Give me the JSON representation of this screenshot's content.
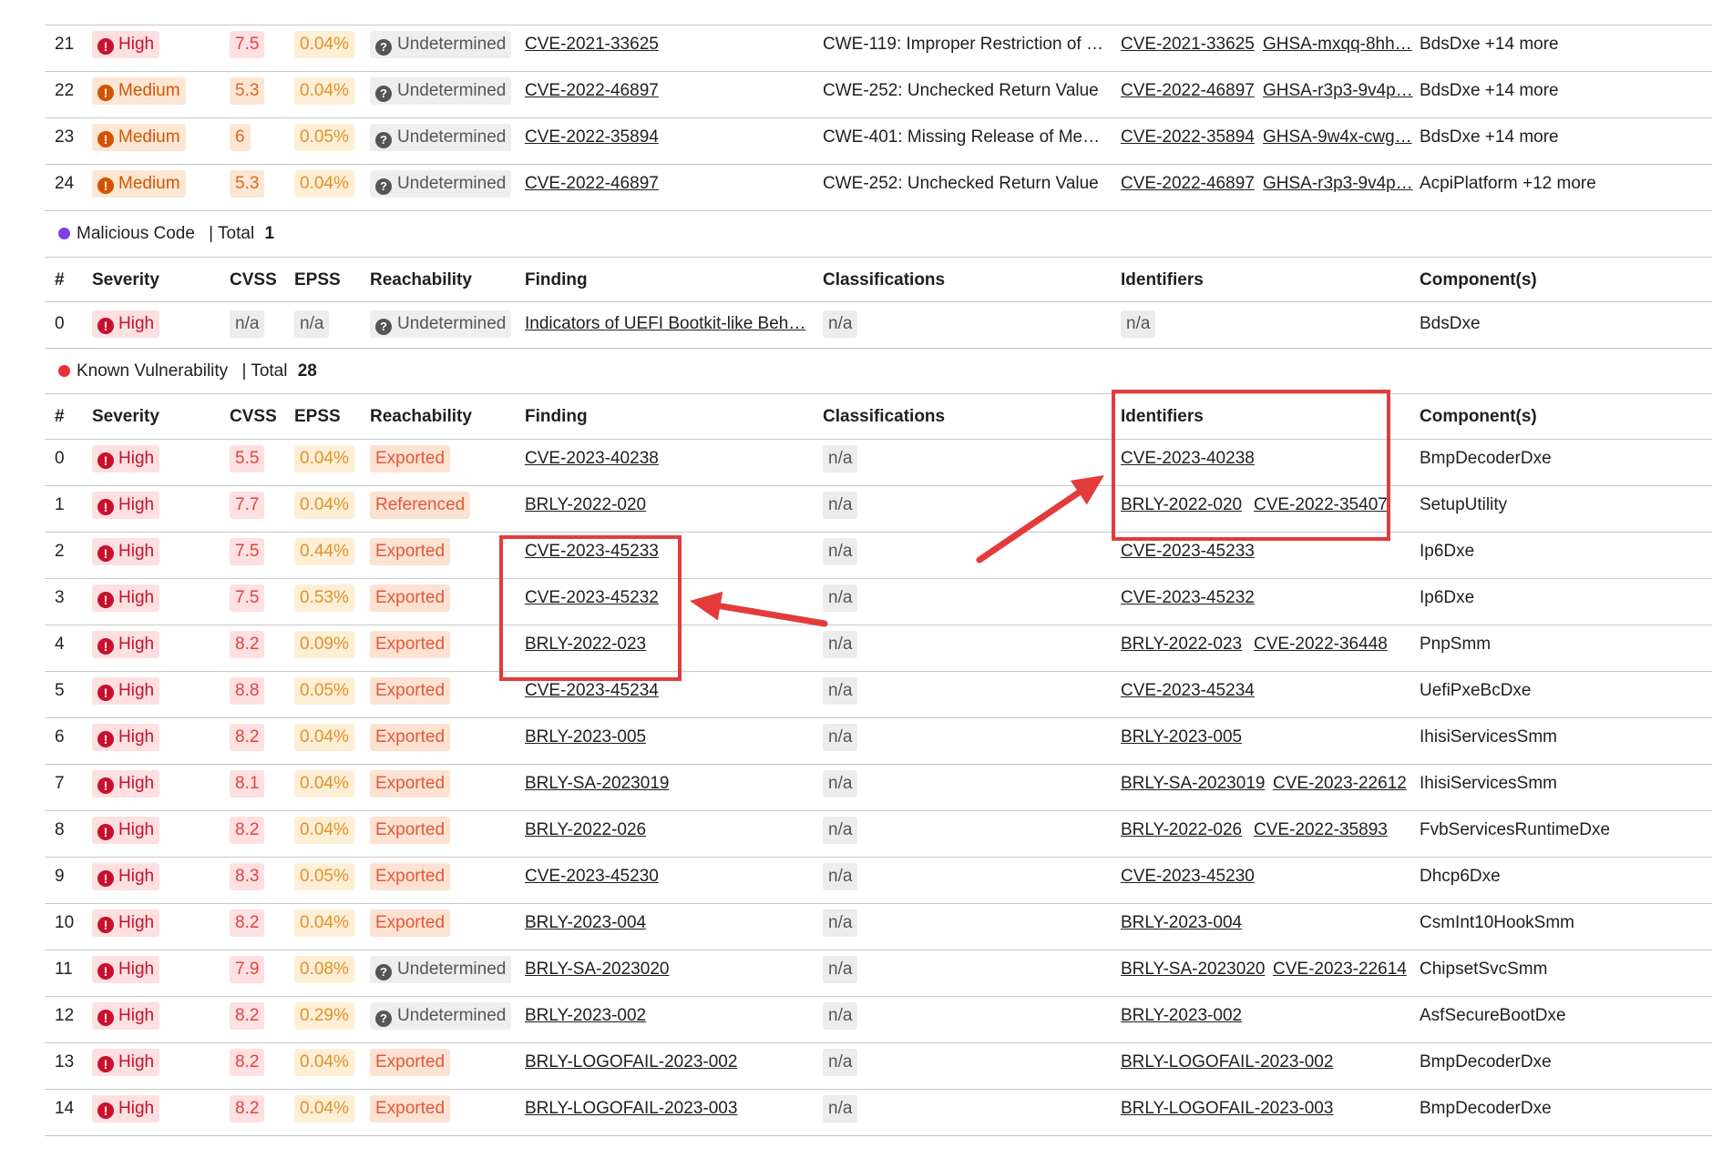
{
  "top_rows": [
    {
      "num": "21",
      "severity": "High",
      "sev_level": "high",
      "cvss": "7.5",
      "cvss_level": "high",
      "epss": "0.04%",
      "reach": "Undetermined",
      "finding": "CVE-2021-33625",
      "classification": "CWE-119: Improper Restriction of …",
      "identifiers": [
        "CVE-2021-33625",
        "GHSA-mxqq-8hh…"
      ],
      "component": "BdsDxe +14 more"
    },
    {
      "num": "22",
      "severity": "Medium",
      "sev_level": "med",
      "cvss": "5.3",
      "cvss_level": "med",
      "epss": "0.04%",
      "reach": "Undetermined",
      "finding": "CVE-2022-46897",
      "classification": "CWE-252: Unchecked Return Value",
      "identifiers": [
        "CVE-2022-46897",
        "GHSA-r3p3-9v4p…"
      ],
      "component": "BdsDxe +14 more"
    },
    {
      "num": "23",
      "severity": "Medium",
      "sev_level": "med",
      "cvss": "6",
      "cvss_level": "med",
      "epss": "0.05%",
      "reach": "Undetermined",
      "finding": "CVE-2022-35894",
      "classification": "CWE-401: Missing Release of Me…",
      "identifiers": [
        "CVE-2022-35894",
        "GHSA-9w4x-cwg…"
      ],
      "component": "BdsDxe +14 more"
    },
    {
      "num": "24",
      "severity": "Medium",
      "sev_level": "med",
      "cvss": "5.3",
      "cvss_level": "med",
      "epss": "0.04%",
      "reach": "Undetermined",
      "finding": "CVE-2022-46897",
      "classification": "CWE-252: Unchecked Return Value",
      "identifiers": [
        "CVE-2022-46897",
        "GHSA-r3p3-9v4p…"
      ],
      "component": "AcpiPlatform +12 more"
    }
  ],
  "malicious": {
    "label": "Malicious Code",
    "total_label": "| Total",
    "total": "1",
    "dot_color": "#7b3fe4",
    "headers": {
      "num": "#",
      "severity": "Severity",
      "cvss": "CVSS",
      "epss": "EPSS",
      "reachability": "Reachability",
      "finding": "Finding",
      "classifications": "Classifications",
      "identifiers": "Identifiers",
      "components": "Component(s)"
    },
    "row": {
      "num": "0",
      "severity": "High",
      "cvss": "n/a",
      "epss": "n/a",
      "reach": "Undetermined",
      "finding": "Indicators of UEFI Bootkit-like Beh…",
      "classification": "n/a",
      "identifiers": "n/a",
      "component": "BdsDxe"
    }
  },
  "known": {
    "label": "Known Vulnerability",
    "total_label": "| Total",
    "total": "28",
    "dot_color": "#e8303a",
    "headers": {
      "num": "#",
      "severity": "Severity",
      "cvss": "CVSS",
      "epss": "EPSS",
      "reachability": "Reachability",
      "finding": "Finding",
      "classifications": "Classifications",
      "identifiers": "Identifiers",
      "components": "Component(s)"
    },
    "rows": [
      {
        "num": "0",
        "severity": "High",
        "cvss": "5.5",
        "epss": "0.04%",
        "reach": "Exported",
        "finding": "CVE-2023-40238",
        "classification": "n/a",
        "identifiers": [
          "CVE-2023-40238"
        ],
        "component": "BmpDecoderDxe"
      },
      {
        "num": "1",
        "severity": "High",
        "cvss": "7.7",
        "epss": "0.04%",
        "reach": "Referenced",
        "finding": "BRLY-2022-020",
        "classification": "n/a",
        "identifiers": [
          "BRLY-2022-020",
          "CVE-2022-35407"
        ],
        "component": "SetupUtility"
      },
      {
        "num": "2",
        "severity": "High",
        "cvss": "7.5",
        "epss": "0.44%",
        "reach": "Exported",
        "finding": "CVE-2023-45233",
        "classification": "n/a",
        "identifiers": [
          "CVE-2023-45233"
        ],
        "component": "Ip6Dxe"
      },
      {
        "num": "3",
        "severity": "High",
        "cvss": "7.5",
        "epss": "0.53%",
        "reach": "Exported",
        "finding": "CVE-2023-45232",
        "classification": "n/a",
        "identifiers": [
          "CVE-2023-45232"
        ],
        "component": "Ip6Dxe"
      },
      {
        "num": "4",
        "severity": "High",
        "cvss": "8.2",
        "epss": "0.09%",
        "reach": "Exported",
        "finding": "BRLY-2022-023",
        "classification": "n/a",
        "identifiers": [
          "BRLY-2022-023",
          "CVE-2022-36448"
        ],
        "component": "PnpSmm"
      },
      {
        "num": "5",
        "severity": "High",
        "cvss": "8.8",
        "epss": "0.05%",
        "reach": "Exported",
        "finding": "CVE-2023-45234",
        "classification": "n/a",
        "identifiers": [
          "CVE-2023-45234"
        ],
        "component": "UefiPxeBcDxe"
      },
      {
        "num": "6",
        "severity": "High",
        "cvss": "8.2",
        "epss": "0.04%",
        "reach": "Exported",
        "finding": "BRLY-2023-005",
        "classification": "n/a",
        "identifiers": [
          "BRLY-2023-005"
        ],
        "component": "IhisiServicesSmm"
      },
      {
        "num": "7",
        "severity": "High",
        "cvss": "8.1",
        "epss": "0.04%",
        "reach": "Exported",
        "finding": "BRLY-SA-2023019",
        "classification": "n/a",
        "identifiers": [
          "BRLY-SA-2023019",
          "CVE-2023-22612"
        ],
        "component": "IhisiServicesSmm"
      },
      {
        "num": "8",
        "severity": "High",
        "cvss": "8.2",
        "epss": "0.04%",
        "reach": "Exported",
        "finding": "BRLY-2022-026",
        "classification": "n/a",
        "identifiers": [
          "BRLY-2022-026",
          "CVE-2022-35893"
        ],
        "component": "FvbServicesRuntimeDxe"
      },
      {
        "num": "9",
        "severity": "High",
        "cvss": "8.3",
        "epss": "0.05%",
        "reach": "Exported",
        "finding": "CVE-2023-45230",
        "classification": "n/a",
        "identifiers": [
          "CVE-2023-45230"
        ],
        "component": "Dhcp6Dxe"
      },
      {
        "num": "10",
        "severity": "High",
        "cvss": "8.2",
        "epss": "0.04%",
        "reach": "Exported",
        "finding": "BRLY-2023-004",
        "classification": "n/a",
        "identifiers": [
          "BRLY-2023-004"
        ],
        "component": "CsmInt10HookSmm"
      },
      {
        "num": "11",
        "severity": "High",
        "cvss": "7.9",
        "epss": "0.08%",
        "reach": "Undetermined",
        "finding": "BRLY-SA-2023020",
        "classification": "n/a",
        "identifiers": [
          "BRLY-SA-2023020",
          "CVE-2023-22614"
        ],
        "component": "ChipsetSvcSmm"
      },
      {
        "num": "12",
        "severity": "High",
        "cvss": "8.2",
        "epss": "0.29%",
        "reach": "Undetermined",
        "finding": "BRLY-2023-002",
        "classification": "n/a",
        "identifiers": [
          "BRLY-2023-002"
        ],
        "component": "AsfSecureBootDxe"
      },
      {
        "num": "13",
        "severity": "High",
        "cvss": "8.2",
        "epss": "0.04%",
        "reach": "Exported",
        "finding": "BRLY-LOGOFAIL-2023-002",
        "classification": "n/a",
        "identifiers": [
          "BRLY-LOGOFAIL-2023-002"
        ],
        "component": "BmpDecoderDxe"
      },
      {
        "num": "14",
        "severity": "High",
        "cvss": "8.2",
        "epss": "0.04%",
        "reach": "Exported",
        "finding": "BRLY-LOGOFAIL-2023-003",
        "classification": "n/a",
        "identifiers": [
          "BRLY-LOGOFAIL-2023-003"
        ],
        "component": "BmpDecoderDxe"
      }
    ]
  },
  "annotation_color": "#e33b3b"
}
